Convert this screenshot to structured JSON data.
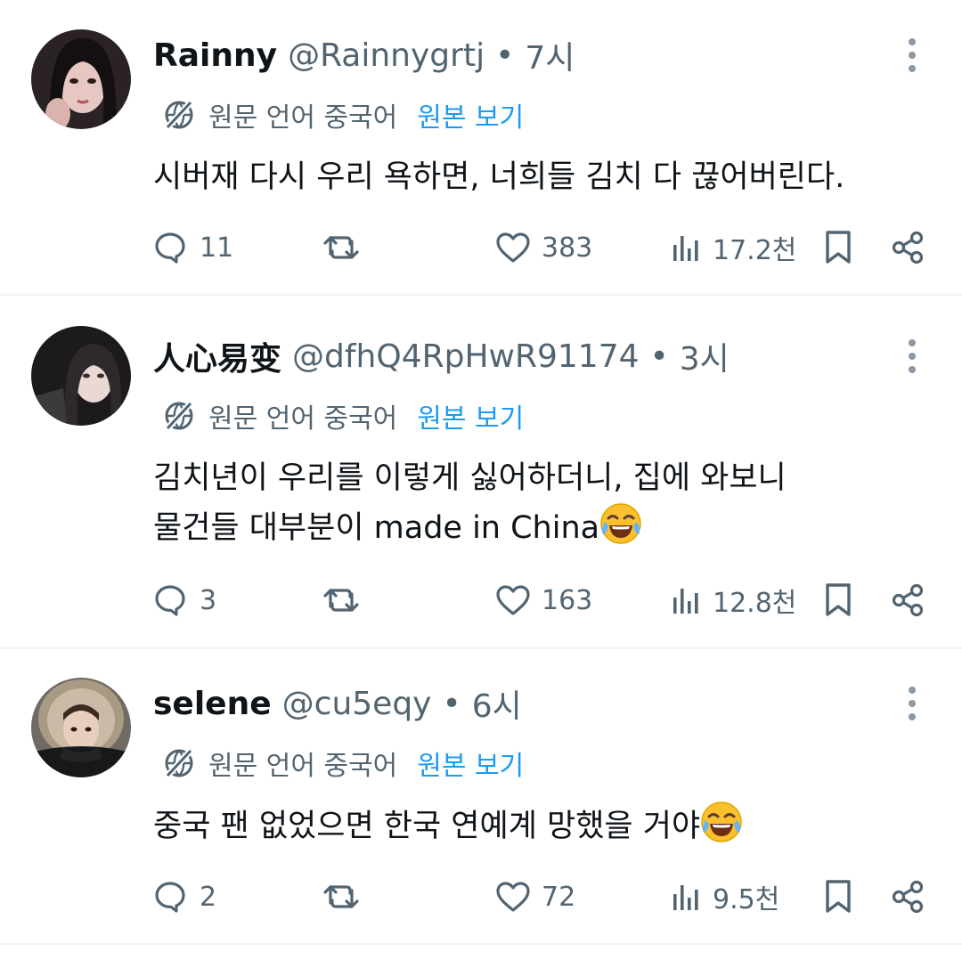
{
  "colors": {
    "text": "#0f1419",
    "muted": "#536471",
    "link": "#1d9bf0",
    "divider": "#eff3f4"
  },
  "tweets": [
    {
      "name": "Rainny",
      "handle": "@Rainnygrtj",
      "separator": "•",
      "time": "7시",
      "translation_note": "원문 언어 중국어",
      "show_original": "원본 보기",
      "text_lines": [
        "시버재 다시 우리 욕하면, 너희들 김치 다 끊어버린다."
      ],
      "replies": "11",
      "likes": "383",
      "views": "17.2천",
      "avatar": "woman-portrait-avatar"
    },
    {
      "name": "人心易变",
      "handle": "@dfhQ4RpHwR91174",
      "separator": "•",
      "time": "3시",
      "translation_note": "원문 언어 중국어",
      "show_original": "원본 보기",
      "text_lines": [
        "김치년이 우리를 이렇게 싫어하더니, 집에 와보니",
        "물건들 대부분이 made in China"
      ],
      "replies": "3",
      "likes": "163",
      "views": "12.8천",
      "avatar": "woman-portrait-avatar"
    },
    {
      "name": "selene",
      "handle": "@cu5eqy",
      "separator": "•",
      "time": "6시",
      "translation_note": "원문 언어 중국어",
      "show_original": "원본 보기",
      "text_lines": [
        "중국 팬 없었으면 한국 연예계 망했을 거야"
      ],
      "replies": "2",
      "likes": "72",
      "views": "9.5천",
      "avatar": "fur-hood-portrait-avatar"
    }
  ],
  "icons": {
    "more": "more-vertical-icon",
    "translate": "globe-slash-icon",
    "reply": "reply-icon",
    "retweet": "retweet-icon",
    "like": "heart-icon",
    "views": "views-chart-icon",
    "bookmark": "bookmark-icon",
    "share": "share-icon",
    "emoji": "tears-of-joy-emoji"
  }
}
